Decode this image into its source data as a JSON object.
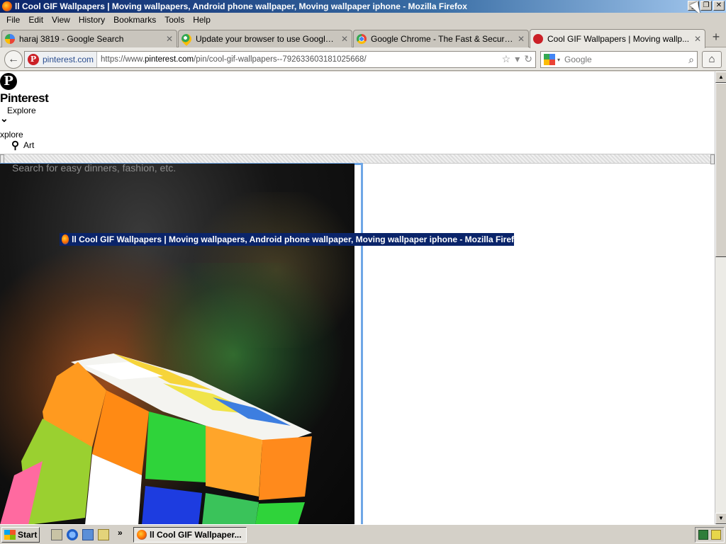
{
  "window": {
    "title": "ll Cool GIF Wallpapers | Moving wallpapers, Android phone wallpaper, Moving wallpaper iphone - Mozilla Firefox",
    "pause_glyph": "II",
    "minimize": "_",
    "restore": "❐",
    "close": "✕"
  },
  "menu": [
    {
      "label": "File"
    },
    {
      "label": "Edit"
    },
    {
      "label": "View"
    },
    {
      "label": "History"
    },
    {
      "label": "Bookmarks"
    },
    {
      "label": "Tools"
    },
    {
      "label": "Help"
    }
  ],
  "tabs": [
    {
      "label": "haraj 3819 - Google Search",
      "icon": "google-icon",
      "close": "✕"
    },
    {
      "label": "Update your browser to use Google Maps ...",
      "icon": "maps-pin-icon",
      "close": "✕"
    },
    {
      "label": "Google Chrome - The Fast & Secure Web ...",
      "icon": "chrome-icon",
      "close": "✕"
    },
    {
      "label": "Cool GIF Wallpapers | Moving wallp...",
      "icon": "pinterest-icon",
      "close": "✕",
      "active": true
    }
  ],
  "new_tab": "+",
  "nav": {
    "back": "←",
    "site_badge": "pinterest.com",
    "url_prefix": "https://www.",
    "url_host": "pinterest.com",
    "url_path": "/pin/cool-gif-wallpapers--792633603181025668/",
    "star": "☆",
    "dropdown": "▾",
    "reload": "↻",
    "search_placeholder": "Google",
    "search_arrow": "▾",
    "magnifier": "⌕",
    "home": "⌂"
  },
  "page": {
    "logo_glyph": "P",
    "brand": "Pinterest",
    "explore_label": "Explore",
    "chevron": "⌄",
    "explore_label_clipped": "xplore",
    "search_icon": "⚲",
    "art_label": "Art",
    "search_placeholder": "Search for easy dinners, fashion, etc.",
    "drag_title": "ll Cool GIF Wallpapers | Moving wallpapers, Android phone wallpaper, Moving wallpaper iphone - Mozilla Firef"
  },
  "scrollbar": {
    "up": "▲",
    "down": "▼"
  },
  "taskbar": {
    "start": "Start",
    "more": "»",
    "task_button": "ll Cool GIF Wallpaper..."
  },
  "colors": {
    "titlebar": "#0a246a",
    "pinterest_red": "#cb2027",
    "selection_border": "#6ea6e6"
  }
}
